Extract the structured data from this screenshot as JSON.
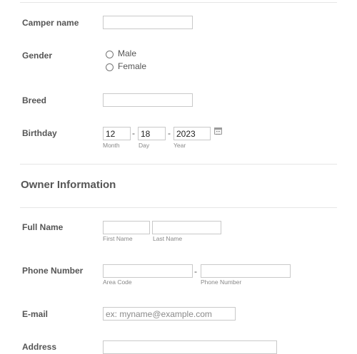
{
  "pet_section": {
    "camper_name": {
      "label": "Camper name",
      "value": ""
    },
    "gender": {
      "label": "Gender",
      "options": [
        "Male",
        "Female"
      ]
    },
    "breed": {
      "label": "Breed",
      "value": ""
    },
    "birthday": {
      "label": "Birthday",
      "month": "12",
      "day": "18",
      "year": "2023",
      "month_label": "Month",
      "day_label": "Day",
      "year_label": "Year",
      "separator": "-",
      "calendar_icon": "calendar-icon"
    }
  },
  "owner_section": {
    "title": "Owner Information",
    "full_name": {
      "label": "Full Name",
      "first_sub": "First Name",
      "last_sub": "Last Name"
    },
    "phone": {
      "label": "Phone Number",
      "area_sub": "Area Code",
      "number_sub": "Phone Number",
      "separator": "-"
    },
    "email": {
      "label": "E-mail",
      "placeholder": "ex: myname@example.com"
    },
    "address": {
      "label": "Address"
    }
  }
}
